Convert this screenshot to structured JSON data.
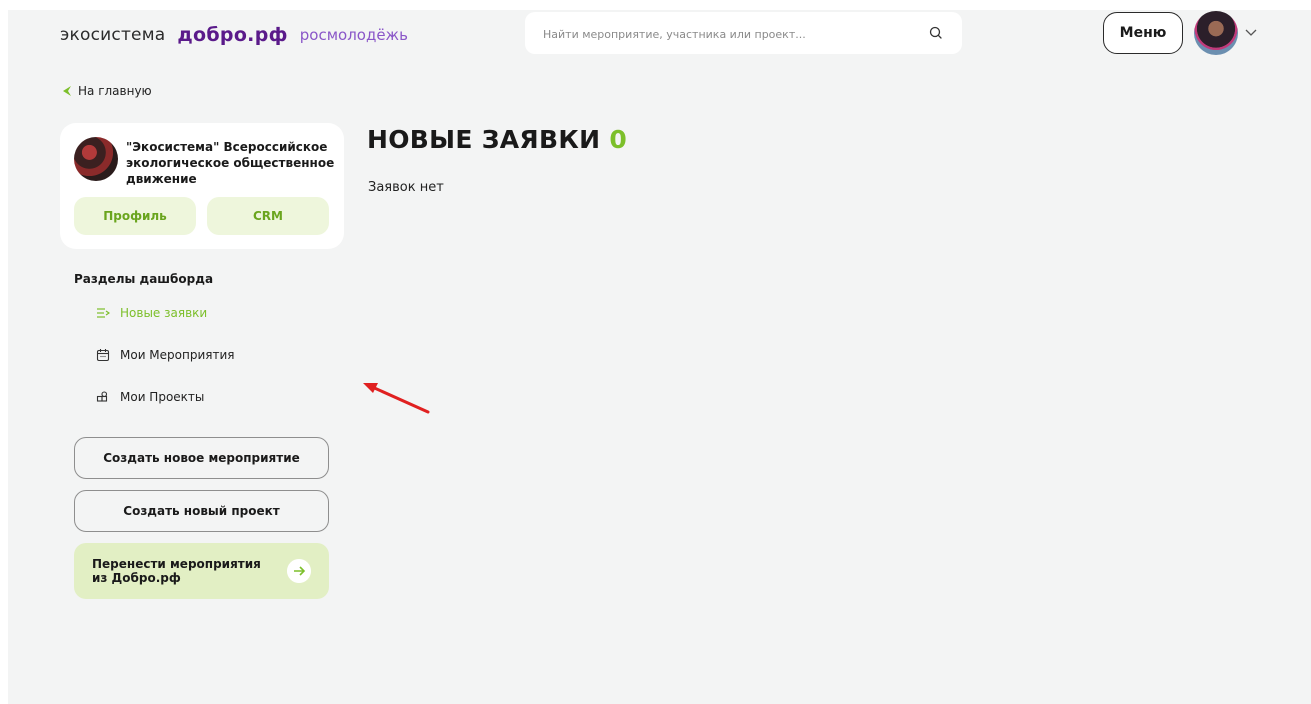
{
  "header": {
    "logos": [
      "экосистема",
      "добро.рф",
      "росмолодёжь"
    ],
    "search_placeholder": "Найти мероприятие, участника или проект...",
    "menu_label": "Меню"
  },
  "back_link": "На главную",
  "org": {
    "name": "\"Экосистема\" Всероссийское экологическое общественное движение",
    "profile_label": "Профиль",
    "crm_label": "CRM"
  },
  "dashboard": {
    "title": "Разделы дашборда",
    "items": [
      {
        "label": "Новые заявки",
        "icon": "list-arrow-icon",
        "active": true
      },
      {
        "label": "Мои Мероприятия",
        "icon": "calendar-icon",
        "active": false
      },
      {
        "label": "Мои Проекты",
        "icon": "grid-icon",
        "active": false
      }
    ]
  },
  "actions": {
    "create_event": "Создать новое мероприятие",
    "create_project": "Создать новый проект",
    "transfer": "Перенести мероприятия из Добро.рф"
  },
  "main": {
    "title": "НОВЫЕ ЗАЯВКИ",
    "count": "0",
    "empty_text": "Заявок нет"
  },
  "colors": {
    "accent_green": "#7cbf2a",
    "dobro_purple": "#5a1a8a",
    "annotation_red": "#e02020"
  }
}
